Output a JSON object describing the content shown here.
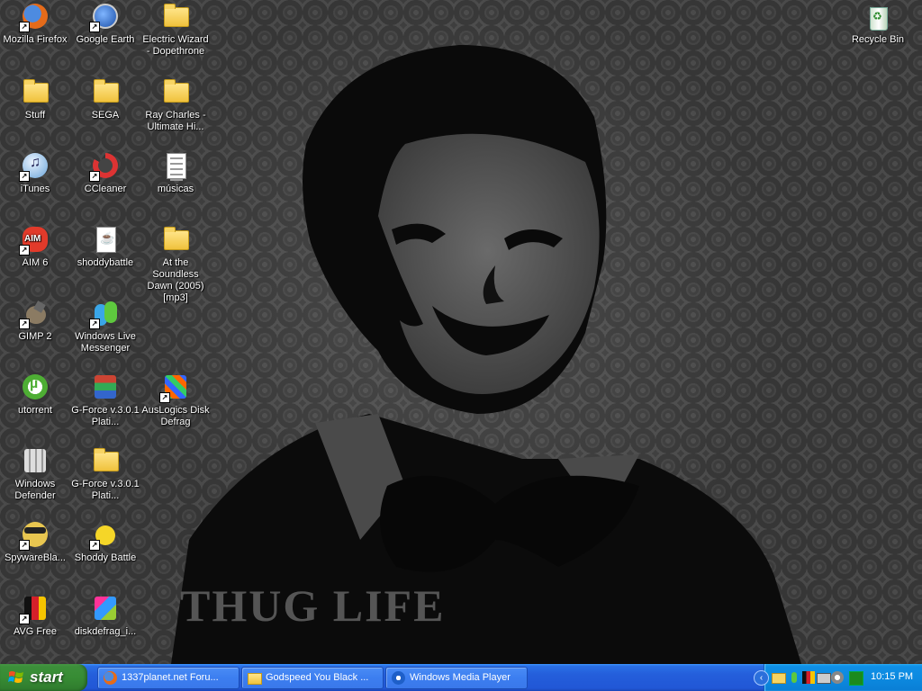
{
  "desktop_icons": [
    {
      "label": "Mozilla Firefox",
      "icon": "firefox-icon",
      "shortcut": true
    },
    {
      "label": "Google Earth",
      "icon": "google-earth-icon",
      "shortcut": true
    },
    {
      "label": "Electric Wizard - Dopethrone",
      "icon": "folder-icon",
      "shortcut": false
    },
    {
      "label": "Stuff",
      "icon": "folder-icon",
      "shortcut": false
    },
    {
      "label": "SEGA",
      "icon": "folder-icon",
      "shortcut": false
    },
    {
      "label": "Ray Charles - Ultimate Hi...",
      "icon": "folder-icon",
      "shortcut": false
    },
    {
      "label": "iTunes",
      "icon": "itunes-icon",
      "shortcut": true
    },
    {
      "label": "CCleaner",
      "icon": "ccleaner-icon",
      "shortcut": true
    },
    {
      "label": "músicas",
      "icon": "text-document-icon",
      "shortcut": false
    },
    {
      "label": "AIM 6",
      "icon": "aim-icon",
      "shortcut": true
    },
    {
      "label": "shoddybattle",
      "icon": "java-file-icon",
      "shortcut": false
    },
    {
      "label": "At the Soundless Dawn (2005)[mp3]",
      "icon": "folder-icon",
      "shortcut": false
    },
    {
      "label": "GIMP 2",
      "icon": "gimp-icon",
      "shortcut": true
    },
    {
      "label": "Windows Live Messenger",
      "icon": "messenger-icon",
      "shortcut": true
    },
    {
      "label": "utorrent",
      "icon": "utorrent-icon",
      "shortcut": false
    },
    {
      "label": "G-Force v.3.0.1 Plati...",
      "icon": "winrar-icon",
      "shortcut": false
    },
    {
      "label": "AusLogics Disk Defrag",
      "icon": "auslogics-icon",
      "shortcut": true
    },
    {
      "label": "Windows Defender",
      "icon": "defender-icon",
      "shortcut": false
    },
    {
      "label": "G-Force v.3.0.1 Plati...",
      "icon": "folder-icon",
      "shortcut": false
    },
    {
      "label": "SpywareBla...",
      "icon": "spywareblaster-icon",
      "shortcut": true
    },
    {
      "label": "Shoddy Battle",
      "icon": "pikachu-icon",
      "shortcut": true
    },
    {
      "label": "AVG Free",
      "icon": "avg-icon",
      "shortcut": true
    },
    {
      "label": "diskdefrag_i...",
      "icon": "installer-icon",
      "shortcut": false
    },
    {
      "label": "Recycle Bin",
      "icon": "recycle-bin-icon",
      "shortcut": false
    }
  ],
  "wallpaper": {
    "text": "THUG LIFE"
  },
  "taskbar": {
    "start_label": "start",
    "tasks": [
      {
        "label": "1337planet.net Foru...",
        "icon": "firefox-icon"
      },
      {
        "label": "Godspeed You Black ...",
        "icon": "folder-icon"
      },
      {
        "label": "Windows Media Player",
        "icon": "media-player-icon"
      }
    ],
    "clock": "10:15 PM"
  },
  "colors": {
    "taskbar": "#245edb",
    "start": "#378c34",
    "tray": "#0c8ae0"
  }
}
